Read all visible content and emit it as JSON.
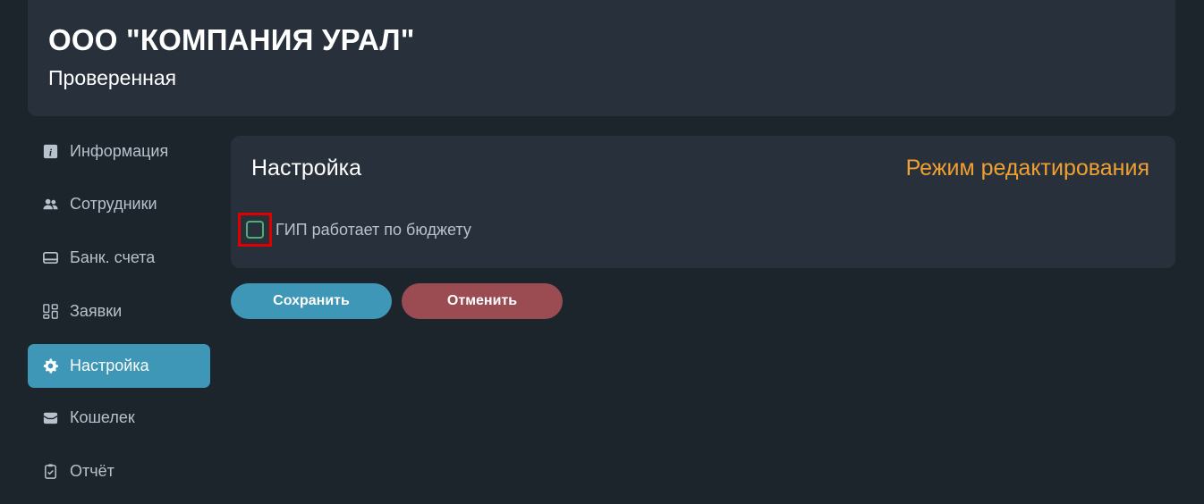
{
  "header": {
    "company_name": "ООО \"КОМПАНИЯ УРАЛ\"",
    "status": "Проверенная"
  },
  "sidebar": {
    "items": [
      {
        "label": "Информация",
        "icon": "info-icon",
        "active": false
      },
      {
        "label": "Сотрудники",
        "icon": "users-icon",
        "active": false
      },
      {
        "label": "Банк. счета",
        "icon": "card-icon",
        "active": false
      },
      {
        "label": "Заявки",
        "icon": "grid-icon",
        "active": false
      },
      {
        "label": "Настройка",
        "icon": "gear-icon",
        "active": true
      },
      {
        "label": "Кошелек",
        "icon": "wallet-icon",
        "active": false
      },
      {
        "label": "Отчёт",
        "icon": "clipboard-icon",
        "active": false
      }
    ]
  },
  "panel": {
    "title": "Настройка",
    "mode": "Режим редактирования",
    "checkbox_label": "ГИП работает по бюджету",
    "checkbox_checked": false
  },
  "actions": {
    "save_label": "Сохранить",
    "cancel_label": "Отменить"
  },
  "colors": {
    "background": "#1c242c",
    "card": "#28313b",
    "accent": "#3e97b6",
    "mode_text": "#f0a030",
    "cancel": "#9a4c52",
    "checkbox_border": "#4caf78",
    "highlight": "#e00000"
  }
}
